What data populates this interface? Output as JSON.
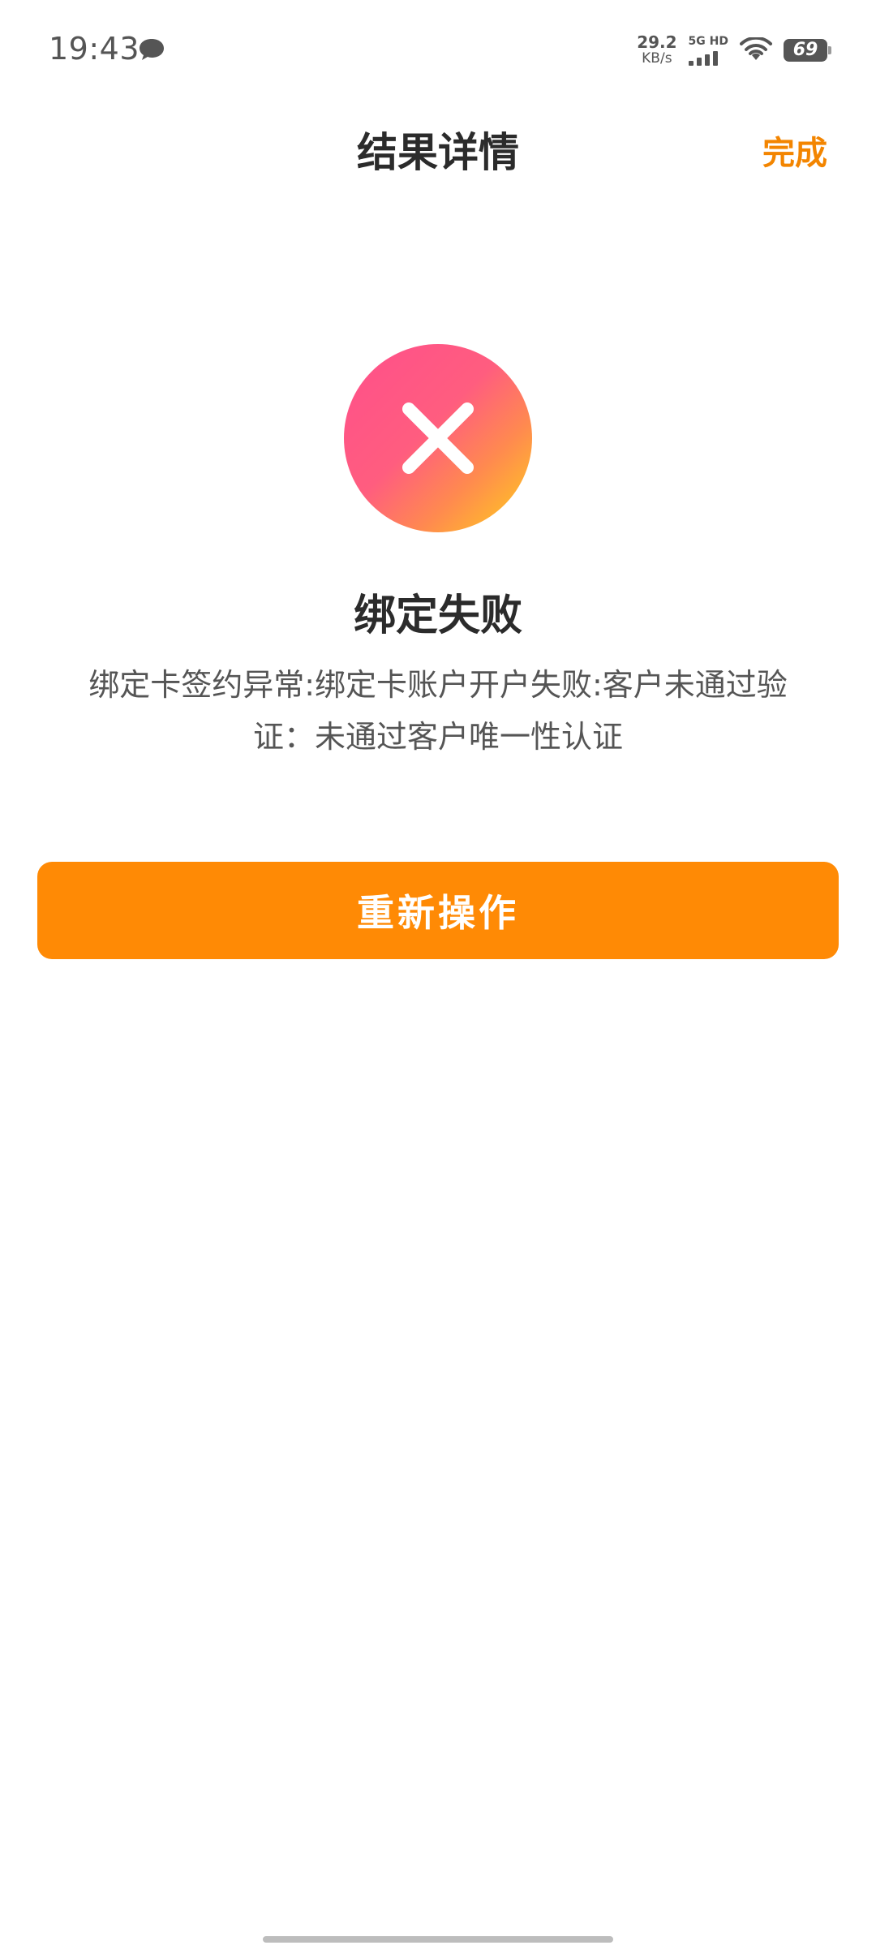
{
  "status_bar": {
    "time": "19:43",
    "net_speed_value": "29.2",
    "net_speed_unit": "KB/s",
    "network_label": "5G HD",
    "battery_level": "69",
    "icons": [
      "message-icon",
      "signal-icon",
      "wifi-icon",
      "battery-icon"
    ]
  },
  "header": {
    "title": "结果详情",
    "done_label": "完成"
  },
  "result": {
    "icon": "close-icon",
    "title": "绑定失败",
    "message": "绑定卡签约异常:绑定卡账户开户失败:客户未通过验证：未通过客户唯一性认证"
  },
  "actions": {
    "retry_label": "重新操作"
  },
  "colors": {
    "accent": "#ff8a05",
    "done_text": "#f38500",
    "error_gradient_start": "#ff4f8b",
    "error_gradient_end": "#ffd11a"
  }
}
